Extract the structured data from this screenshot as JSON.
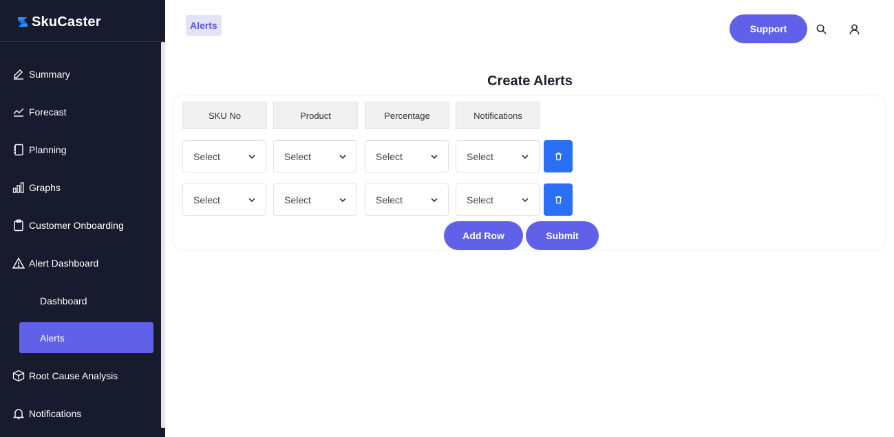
{
  "brand": {
    "name": "SkuCaster",
    "logo_icon": "s-logo-icon",
    "logo_color": "#2b8cf6"
  },
  "sidebar": {
    "items": [
      {
        "label": "Summary",
        "icon": "pencil-icon"
      },
      {
        "label": "Forecast",
        "icon": "trend-line-icon"
      },
      {
        "label": "Planning",
        "icon": "notebook-icon"
      },
      {
        "label": "Graphs",
        "icon": "bar-chart-icon"
      },
      {
        "label": "Customer Onboarding",
        "icon": "clipboard-icon"
      },
      {
        "label": "Alert Dashboard",
        "icon": "warning-icon"
      },
      {
        "label": "Root Cause Analysis",
        "icon": "box-icon"
      },
      {
        "label": "Notifications",
        "icon": "bell-icon"
      }
    ],
    "subitems": [
      {
        "label": "Dashboard",
        "active": false
      },
      {
        "label": "Alerts",
        "active": true
      }
    ],
    "active_color": "#6061e8",
    "background": "#181a2e"
  },
  "header": {
    "breadcrumb": "Alerts",
    "support_label": "Support",
    "search_icon": "search-icon",
    "user_icon": "user-icon"
  },
  "main": {
    "title": "Create Alerts",
    "columns": [
      "SKU No",
      "Product",
      "Percentage",
      "Notifications"
    ],
    "rows": [
      {
        "sku": "Select",
        "product": "Select",
        "percentage": "Select",
        "notifications": "Select"
      },
      {
        "sku": "Select",
        "product": "Select",
        "percentage": "Select",
        "notifications": "Select"
      }
    ],
    "delete_icon": "trash-icon",
    "delete_color": "#2b6ff6",
    "add_row_label": "Add Row",
    "submit_label": "Submit",
    "accent": "#6061e8"
  }
}
